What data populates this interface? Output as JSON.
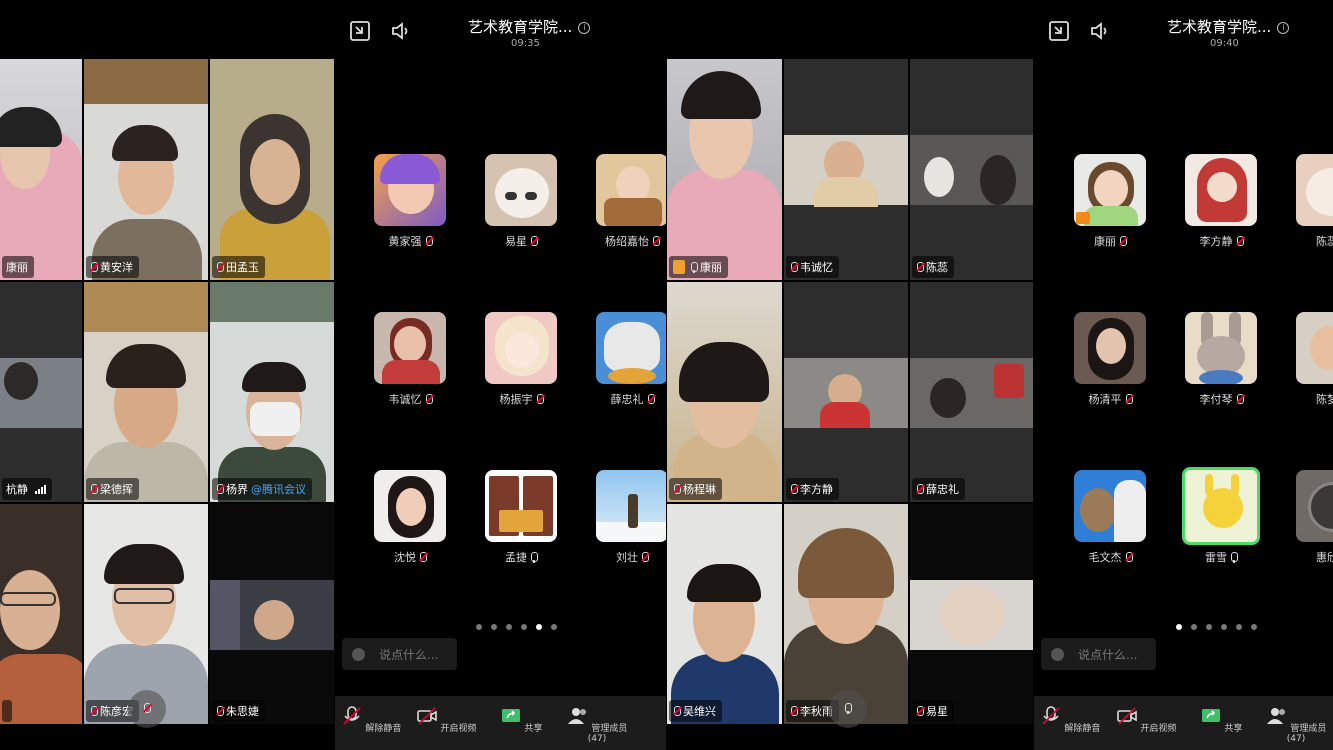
{
  "panel1": {
    "tiles": [
      {
        "name": "康丽"
      },
      {
        "name": "黄安洋"
      },
      {
        "name": "田孟玉"
      },
      {
        "name": "杭静"
      },
      {
        "name": "梁德挥"
      },
      {
        "name": "杨界",
        "suffix": "@腾讯会议"
      },
      {
        "name": ""
      },
      {
        "name": "陈彦宏"
      },
      {
        "name": "朱思婕"
      }
    ]
  },
  "panel2": {
    "title": "艺术教育学院...",
    "time": "09:35",
    "avatars": [
      {
        "name": "黄家强"
      },
      {
        "name": "易星"
      },
      {
        "name": "杨绍嘉怡"
      },
      {
        "name": "韦诚忆"
      },
      {
        "name": "杨振宇"
      },
      {
        "name": "薛忠礼"
      },
      {
        "name": "沈悦"
      },
      {
        "name": "孟捷"
      },
      {
        "name": "刘壮"
      }
    ],
    "chat_placeholder": "说点什么...",
    "toolbar": {
      "unmute": "解除静音",
      "video": "开启视频",
      "share": "共享",
      "members": "管理成员 (47)"
    }
  },
  "panel3": {
    "tiles": [
      {
        "name": "康丽"
      },
      {
        "name": "韦诚忆"
      },
      {
        "name": "陈蕊"
      },
      {
        "name": "杨程琳"
      },
      {
        "name": "李方静"
      },
      {
        "name": "薛忠礼"
      },
      {
        "name": "吴维兴"
      },
      {
        "name": "李秋雨"
      },
      {
        "name": "易星"
      }
    ]
  },
  "panel4": {
    "title": "艺术教育学院...",
    "time": "09:40",
    "avatars": [
      {
        "name": "康丽"
      },
      {
        "name": "李方静"
      },
      {
        "name": "陈蕊"
      },
      {
        "name": "杨清平"
      },
      {
        "name": "李付琴"
      },
      {
        "name": "陈梦"
      },
      {
        "name": "毛文杰"
      },
      {
        "name": "雷雪"
      },
      {
        "name": "惠欣"
      }
    ],
    "chat_placeholder": "说点什么...",
    "toolbar": {
      "unmute": "解除静音",
      "video": "开启视频",
      "share": "共享",
      "members": "管理成员 (47)"
    }
  },
  "colors": {
    "background": "#000000",
    "toolbar": "#1c1c1c",
    "mute_red": "#e00033",
    "link_blue": "#4aa3ff",
    "speaking_green": "#4cd964"
  },
  "icons": [
    "minimize-icon",
    "speaker-icon",
    "info-icon",
    "mic-off-icon",
    "video-off-icon",
    "share-icon",
    "members-icon",
    "emoji-icon"
  ]
}
